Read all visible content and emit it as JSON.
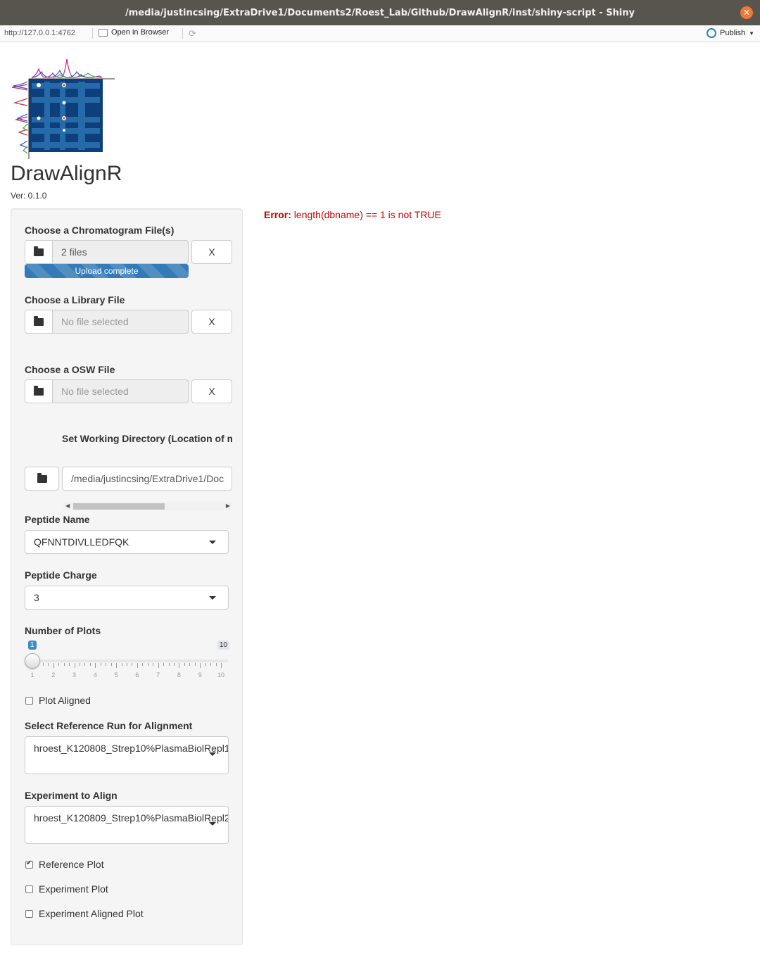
{
  "window": {
    "title": "/media/justincsing/ExtraDrive1/Documents2/Roest_Lab/Github/DrawAlignR/inst/shiny-script - Shiny",
    "close_icon": "close-icon"
  },
  "toolbar": {
    "url": "http://127.0.0.1:4762",
    "open_in_browser": "Open in Browser",
    "publish": "Publish"
  },
  "app": {
    "title": "DrawAlignR",
    "version": "Ver: 0.1.0"
  },
  "sidebar": {
    "chromatogram": {
      "label": "Choose a Chromatogram File(s)",
      "value": "2 files",
      "clear": "X",
      "progress_text": "Upload complete",
      "progress": 1.0
    },
    "library": {
      "label": "Choose a Library File",
      "placeholder": "No file selected",
      "clear": "X"
    },
    "osw": {
      "label": "Choose a OSW File",
      "placeholder": "No file selected",
      "clear": "X"
    },
    "working_dir": {
      "label": "Set Working Directory (Location of m",
      "value": "/media/justincsing/ExtraDrive1/Doc"
    },
    "peptide_name": {
      "label": "Peptide Name",
      "value": "QFNNTDIVLLEDFQK"
    },
    "peptide_charge": {
      "label": "Peptide Charge",
      "value": "3"
    },
    "num_plots": {
      "label": "Number of Plots",
      "min": "1",
      "max": "10",
      "value": 1,
      "ticks": [
        "1",
        "2",
        "3",
        "4",
        "5",
        "6",
        "7",
        "8",
        "9",
        "10"
      ]
    },
    "plot_aligned": {
      "label": "Plot Aligned",
      "checked": false
    },
    "reference_run": {
      "label": "Select Reference Run for Alignment",
      "value": "hroest_K120808_Strep10%PlasmaBiolRepl1"
    },
    "experiment": {
      "label": "Experiment to Align",
      "value": "hroest_K120809_Strep10%PlasmaBiolRepl2"
    },
    "reference_plot": {
      "label": "Reference Plot",
      "checked": true
    },
    "experiment_plot": {
      "label": "Experiment Plot",
      "checked": false
    },
    "experiment_aligned_plot": {
      "label": "Experiment Aligned Plot",
      "checked": false
    }
  },
  "main": {
    "error_prefix": "Error:",
    "error_message": "length(dbname) == 1 is not TRUE"
  },
  "colors": {
    "accent": "#337ab7",
    "error": "#cc0000",
    "titlebar": "#58554f",
    "close": "#f27835"
  }
}
